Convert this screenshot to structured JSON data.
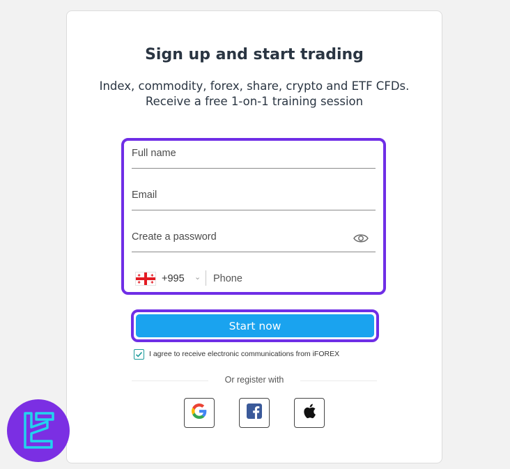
{
  "header": {
    "title": "Sign up and start trading",
    "subtitle_line1": "Index, commodity, forex, share, crypto and ETF CFDs.",
    "subtitle_line2": "Receive a free 1-on-1 training session"
  },
  "form": {
    "full_name_placeholder": "Full name",
    "email_placeholder": "Email",
    "password_placeholder": "Create a password",
    "phone": {
      "country_flag": "georgia-flag-icon",
      "dial_code": "+995",
      "placeholder": "Phone"
    }
  },
  "actions": {
    "start_label": "Start now",
    "consent_text": "I agree to receive electronic communications from iFOREX",
    "consent_checked": true,
    "or_register_with": "Or register with"
  },
  "social": [
    "google-icon",
    "facebook-icon",
    "apple-icon"
  ],
  "colors": {
    "highlight": "#6f2ee6",
    "button": "#1aa3ef",
    "title": "#2a3542",
    "logo_bg": "#7b2fe3",
    "logo_fg": "#22d3ee"
  }
}
